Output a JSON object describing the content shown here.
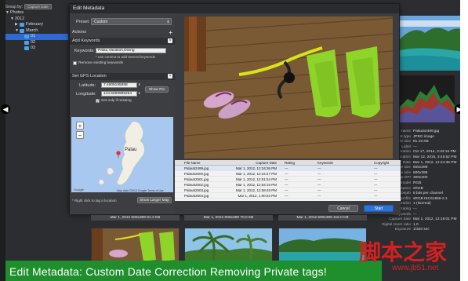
{
  "sidebar": {
    "group_by_label": "Group by:",
    "group_by_value": "Capture Date",
    "tree": [
      {
        "label": "Photos",
        "level": 0,
        "expanded": true
      },
      {
        "label": "2012",
        "level": 1,
        "expanded": true
      },
      {
        "label": "February",
        "level": 2,
        "expanded": false
      },
      {
        "label": "March",
        "level": 2,
        "expanded": true
      },
      {
        "label": "01",
        "level": 3,
        "selected": true
      },
      {
        "label": "02",
        "level": 3
      },
      {
        "label": "03",
        "level": 3
      }
    ]
  },
  "dialog": {
    "title": "Edit Metadata",
    "preset_label": "Preset:",
    "preset_value": "Custom",
    "actions_label": "Actions",
    "add_keywords_label": "Add Keywords",
    "keywords_label": "Keywords:",
    "keywords_value": "Palau,Vacation,Diving",
    "keywords_note": "* use comma to add several keywords",
    "remove_existing_label": "Remove existing keywords",
    "gps_section_label": "Set GPS Location",
    "latitude_label": "Latitude:",
    "latitude_value": "7.4809195888",
    "longitude_label": "Longitude:",
    "longitude_value": "134.5069985254",
    "show_pin_label": "Show Pin",
    "set_only_missing_label": "Set only if missing",
    "map_place_label": "Palau",
    "map_attribution": "Map data ©2013 Google   Terms of Use",
    "map_google": "Google",
    "right_click_note": "* Right click to tag a location.",
    "show_larger_map_label": "Show Larger Map",
    "cancel_label": "Cancel",
    "start_label": "Start",
    "file_table": {
      "headers": [
        "File Name",
        "Capture Date",
        "Rating",
        "Keywords",
        "Copyright"
      ],
      "rows": [
        [
          "Palau52499.jpg",
          "Mar 1, 2012, 12:24:36 PM",
          "---",
          "---",
          "---"
        ],
        [
          "Palau52500.jpg",
          "Mar 1, 2012, 12:24:47 PM",
          "---",
          "---",
          "---"
        ],
        [
          "Palau52501.jpg",
          "Mar 1, 2012, 12:51:54 PM",
          "---",
          "---",
          "---"
        ],
        [
          "Palau52502.jpg",
          "Mar 1, 2012, 12:54:16 PM",
          "---",
          "---",
          "---"
        ],
        [
          "Palau52503.jpg",
          "Mar 1, 2012, 12:59:48 PM",
          "---",
          "---",
          "---"
        ],
        [
          "Palau52504.jpg",
          "Mar 1, 2012, 1:00:23 PM",
          "---",
          "---",
          "---"
        ]
      ]
    }
  },
  "inspector": {
    "rows": [
      {
        "k": "File name",
        "v": "Palau52499.jpg"
      },
      {
        "k": "nt type",
        "v": "JPEG image"
      },
      {
        "k": "File size",
        "v": "81.19 KB"
      },
      {
        "k": "Label",
        "v": "---"
      },
      {
        "k": "reation",
        "v": "Oct 17, 2014, 3:43:16 PM"
      },
      {
        "k": "ification",
        "v": "Mar 12, 2015, 3:45:52 PM"
      },
      {
        "k": "Date",
        "v": "Mar 1, 2012, 12:24:36 PM"
      },
      {
        "k": "e size",
        "v": "600x399"
      },
      {
        "k": "e size",
        "v": "600x399"
      },
      {
        "k": "ge DPI",
        "v": "300x300"
      },
      {
        "k": "model",
        "v": "RGB"
      },
      {
        "k": "r space",
        "v": "sRGB"
      },
      {
        "k": "Depth",
        "v": "8 bits per channel"
      },
      {
        "k": "profile",
        "v": "sRGB IEC61966-2.1"
      },
      {
        "k": "ientation",
        "v": "1 (Normal)"
      },
      {
        "k": "Rating",
        "v": "---"
      },
      {
        "k": "Keywords",
        "v": "---"
      },
      {
        "k": "Capture date",
        "v": "Mar 1, 2012, 12:18:01 PM"
      },
      {
        "k": "Digital zoom ratio",
        "v": "1.0"
      },
      {
        "k": "Exposure",
        "v": "1/320 sec"
      }
    ]
  },
  "thumbnails": [
    {
      "caption": "Mar 1, 2012  600x399  81.2 KB"
    },
    {
      "caption": "Mar 1, 2012  600x399  70.0 KB"
    },
    {
      "caption": "Mar 1, 2012  600x399  116.0 KB"
    }
  ],
  "bottom_caption": "Edit Metadata: Custom   Date Correction   Removing Private tags!",
  "watermark": "脚本之家",
  "watermark_url": "www.jb51.net"
}
